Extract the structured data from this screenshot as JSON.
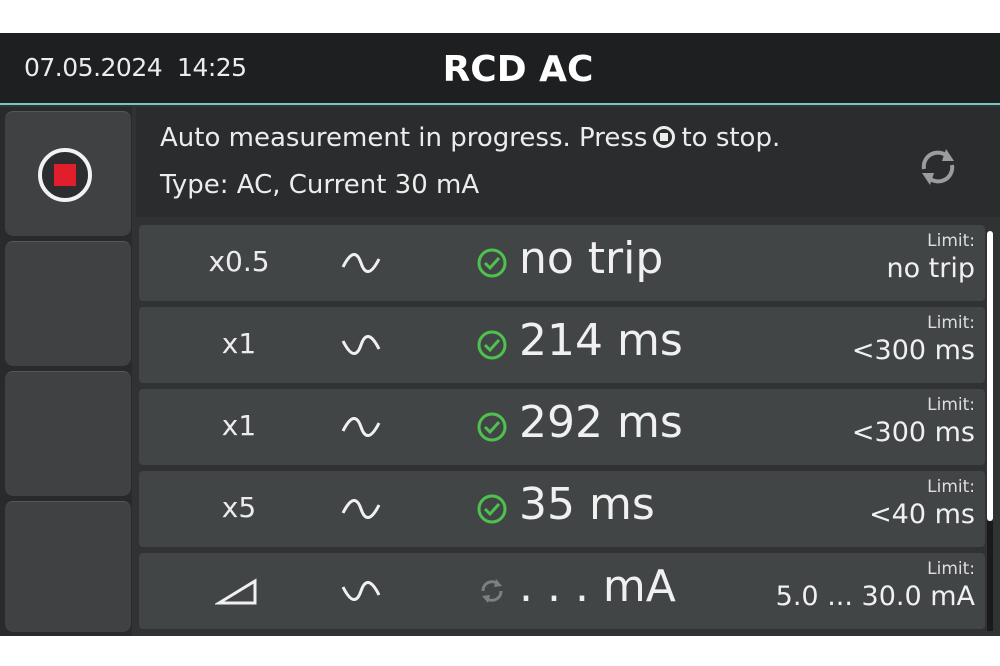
{
  "header": {
    "datetime": "07.05.2024  14:25",
    "title": "RCD AC"
  },
  "sidebar": {
    "stop_button_icon": "stop-icon",
    "stop_color": "#e01e2c"
  },
  "info": {
    "line1_before": "Auto measurement in progress. Press",
    "line1_after": "to stop.",
    "line2": "Type: AC, Current 30 mA",
    "refresh_icon": "refresh-icon"
  },
  "results": [
    {
      "multiplier": "x0.5",
      "wave": "sine-icon",
      "status": "ok",
      "value": "no trip",
      "limit_label": "Limit:",
      "limit_value": "no trip"
    },
    {
      "multiplier": "x1",
      "wave": "sine-icon",
      "status": "ok",
      "value": "214 ms",
      "limit_label": "Limit:",
      "limit_value": "<300 ms"
    },
    {
      "multiplier": "x1",
      "wave": "sine-icon",
      "status": "ok",
      "value": "292 ms",
      "limit_label": "Limit:",
      "limit_value": "<300 ms"
    },
    {
      "multiplier": "x5",
      "wave": "sine-icon",
      "status": "ok",
      "value": "35 ms",
      "limit_label": "Limit:",
      "limit_value": "<40 ms"
    },
    {
      "multiplier": "◿",
      "multiplier_icon": "ramp-icon",
      "wave": "sine-icon",
      "status": "pending",
      "value": ". . . mA",
      "limit_label": "Limit:",
      "limit_value": "5.0 ... 30.0 mA"
    }
  ],
  "colors": {
    "accent_line": "#79c6bf",
    "ok_green": "#4fc14f",
    "stop_red": "#e01e2c"
  }
}
